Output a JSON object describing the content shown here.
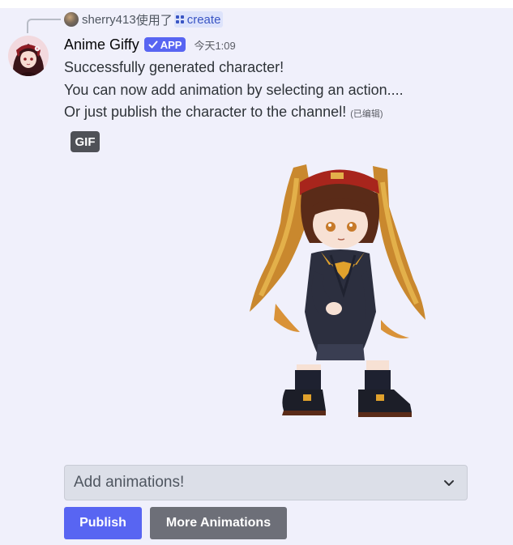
{
  "reply": {
    "username": "sherry413",
    "action": "使用了",
    "command": "create"
  },
  "message": {
    "author": "Anime Giffy",
    "badge": "APP",
    "timestamp": "今天1:09",
    "lines": [
      "Successfully generated character!",
      "You can now add animation by selecting an action....",
      "Or just publish the character to the channel!"
    ],
    "edited": "(已编辑)"
  },
  "attachment": {
    "badge": "GIF"
  },
  "components": {
    "select_placeholder": "Add animations!",
    "publish_label": "Publish",
    "more_label": "More Animations"
  },
  "colors": {
    "blurple": "#5865f2",
    "secondary_button": "#6d6f78",
    "background": "#f0f0fb"
  },
  "icons": {
    "reply_avatar": "user-avatar",
    "command": "slash-command-icon",
    "badge_check": "checkmark-icon",
    "select": "chevron-down-icon"
  }
}
